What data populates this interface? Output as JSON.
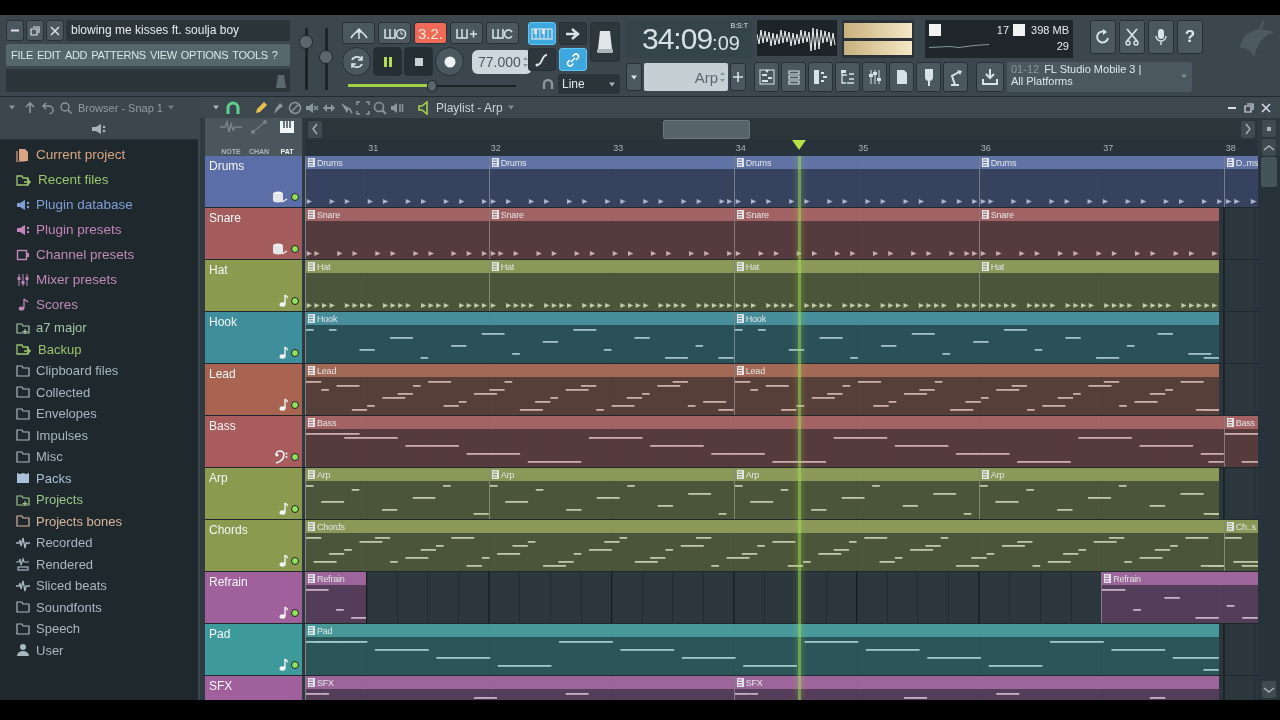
{
  "window": {
    "title": "blowing me kisses ft. soulja boy"
  },
  "menu": [
    "FILE",
    "EDIT",
    "ADD",
    "PATTERNS",
    "VIEW",
    "OPTIONS",
    "TOOLS",
    "?"
  ],
  "master_sliders": [
    {
      "level": 0.85
    },
    {
      "level": 0.55
    }
  ],
  "typing_display": "3.2.",
  "tempo": "77.000",
  "main_pitch": {
    "level": 0.5
  },
  "snap_buttons": [
    {
      "selected": true
    },
    {
      "selected": false
    },
    {
      "selected": false
    },
    {
      "selected": true
    }
  ],
  "snap_mode": "Line",
  "time": {
    "bars": "34:09",
    "ticks": ":09",
    "format": "B:S:T"
  },
  "pattern": "Arp",
  "readouts": [
    "17",
    "398 MB",
    "29"
  ],
  "news": {
    "date": "01-12",
    "headline": "FL Studio Mobile 3 |",
    "subline": "All Platforms"
  },
  "help": "?",
  "browser": {
    "title": "Browser - Snap 1",
    "shortcuts": [
      {
        "label": "Current project",
        "kind": "project",
        "color": "#d9a684"
      },
      {
        "label": "Recent files",
        "kind": "recent",
        "color": "#9cc46c"
      },
      {
        "label": "Plugin database",
        "kind": "plugin",
        "color": "#7f9fd6"
      },
      {
        "label": "Plugin presets",
        "kind": "plugin",
        "color": "#c584b8"
      },
      {
        "label": "Channel presets",
        "kind": "channel",
        "color": "#c08ab8"
      },
      {
        "label": "Mixer presets",
        "kind": "mixer",
        "color": "#c08ab8"
      },
      {
        "label": "Scores",
        "kind": "score",
        "color": "#c08ab8"
      }
    ],
    "folders": [
      {
        "label": "a7 major",
        "kind": "folder-add",
        "color": "#a4c4a8"
      },
      {
        "label": "Backup",
        "kind": "recent",
        "color": "#9cc46c"
      },
      {
        "label": "Clipboard files",
        "kind": "folder",
        "color": "#a8b8c0"
      },
      {
        "label": "Collected",
        "kind": "folder",
        "color": "#a8b8c0"
      },
      {
        "label": "Envelopes",
        "kind": "folder",
        "color": "#a8b8c0"
      },
      {
        "label": "Impulses",
        "kind": "folder",
        "color": "#a8b8c0"
      },
      {
        "label": "Misc",
        "kind": "folder",
        "color": "#a8b8c0"
      },
      {
        "label": "Packs",
        "kind": "packs",
        "color": "#a8c0d8"
      },
      {
        "label": "Projects",
        "kind": "folder-add",
        "color": "#9cc48c"
      },
      {
        "label": "Projects bones",
        "kind": "folder",
        "color": "#d9b49c"
      },
      {
        "label": "Recorded",
        "kind": "wave",
        "color": "#a8b8c0"
      },
      {
        "label": "Rendered",
        "kind": "rendered",
        "color": "#a8b8c0"
      },
      {
        "label": "Sliced beats",
        "kind": "wave",
        "color": "#a8b8c0"
      },
      {
        "label": "Soundfonts",
        "kind": "folder",
        "color": "#a8b8c0"
      },
      {
        "label": "Speech",
        "kind": "folder",
        "color": "#a8b8c0"
      },
      {
        "label": "User",
        "kind": "user",
        "color": "#a8b8c0"
      }
    ]
  },
  "playlist": {
    "title": "Playlist - Arp",
    "modes": [
      {
        "label": "NOTE",
        "selected": false
      },
      {
        "label": "CHAN",
        "selected": false
      },
      {
        "label": "PAT",
        "selected": true
      }
    ],
    "bars": [
      "31",
      "32",
      "33",
      "34",
      "35",
      "36",
      "37",
      "38"
    ],
    "playhead": {
      "level": 0.518
    },
    "tracks": [
      {
        "name": "Drums",
        "color": "#5c6ea8",
        "kind": "drum",
        "enabled": true,
        "clips": [
          {
            "kind": "steps",
            "label": "Drums"
          },
          {
            "kind": "steps",
            "label": "Drums"
          },
          {
            "kind": "steps",
            "label": "Drums"
          },
          {
            "kind": "steps",
            "label": "Drums"
          },
          {
            "kind": "steps",
            "label": "D..ms"
          }
        ]
      },
      {
        "name": "Snare",
        "color": "#a55c5c",
        "kind": "drum",
        "enabled": true,
        "clips": [
          {
            "kind": "steps",
            "label": "Snare"
          },
          {
            "kind": "steps",
            "label": "Snare"
          },
          {
            "kind": "steps",
            "label": "Snare"
          },
          {
            "kind": "steps",
            "label": "Snare"
          }
        ]
      },
      {
        "name": "Hat",
        "color": "#8c9a50",
        "kind": "note",
        "enabled": true,
        "clips": [
          {
            "kind": "steps",
            "label": "Hat"
          },
          {
            "kind": "steps",
            "label": "Hat"
          },
          {
            "kind": "steps",
            "label": "Hat"
          },
          {
            "kind": "steps",
            "label": "Hat"
          }
        ]
      },
      {
        "name": "Hook",
        "color": "#3f8e9c",
        "kind": "note",
        "enabled": true,
        "clips": [
          {
            "kind": "notes",
            "label": "Hook"
          },
          {
            "kind": "notes",
            "label": "Hook"
          }
        ]
      },
      {
        "name": "Lead",
        "color": "#a86450",
        "kind": "note",
        "enabled": true,
        "clips": [
          {
            "kind": "notes",
            "label": "Lead"
          },
          {
            "kind": "notes",
            "label": "Lead"
          }
        ]
      },
      {
        "name": "Bass",
        "color": "#a85c5c",
        "kind": "bass",
        "enabled": true,
        "clips": [
          {
            "kind": "notes",
            "label": "Bass"
          },
          {
            "kind": "notes",
            "label": "Bass"
          }
        ]
      },
      {
        "name": "Arp",
        "color": "#8c9a50",
        "kind": "note",
        "enabled": true,
        "clips": [
          {
            "kind": "notes",
            "label": "Arp"
          },
          {
            "kind": "notes",
            "label": "Arp"
          },
          {
            "kind": "notes",
            "label": "Arp"
          },
          {
            "kind": "notes",
            "label": "Arp"
          }
        ]
      },
      {
        "name": "Chords",
        "color": "#8c9a50",
        "kind": "note",
        "enabled": true,
        "clips": [
          {
            "kind": "notes",
            "label": "Chords"
          },
          {
            "kind": "notes",
            "label": "Ch..s"
          }
        ]
      },
      {
        "name": "Refrain",
        "color": "#a0609c",
        "kind": "note",
        "enabled": true,
        "clips": [
          {
            "kind": "notes",
            "label": "Refrain"
          },
          {
            "kind": "notes",
            "label": "Refrain"
          }
        ]
      },
      {
        "name": "Pad",
        "color": "#3f9a9c",
        "kind": "note",
        "enabled": true,
        "clips": [
          {
            "kind": "notes",
            "label": "Pad"
          }
        ]
      },
      {
        "name": "SFX",
        "color": "#a0609c",
        "clips": [
          {
            "kind": "notes",
            "label": "SFX"
          },
          {
            "kind": "notes",
            "label": "SFX"
          }
        ]
      }
    ]
  }
}
